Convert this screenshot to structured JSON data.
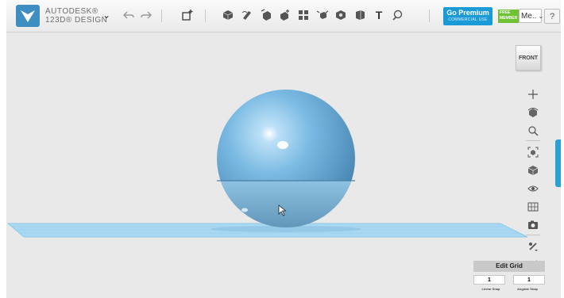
{
  "app": {
    "brand_line1": "AUTODESK®",
    "brand_line2": "123D® DESIGN",
    "logo_icon": "autodesk-logo-icon",
    "menu_caret": "⌄"
  },
  "toolbar": {
    "undo_icon": "undo-icon",
    "redo_icon": "redo-icon",
    "tools": [
      {
        "name": "transform-icon"
      },
      {
        "name": "primitives-icon"
      },
      {
        "name": "sketch-icon"
      },
      {
        "name": "construct-icon"
      },
      {
        "name": "modify-icon"
      },
      {
        "name": "pattern-icon"
      },
      {
        "name": "group-icon"
      },
      {
        "name": "combine-icon"
      },
      {
        "name": "measure-icon"
      },
      {
        "name": "text-icon"
      },
      {
        "name": "snap-icon"
      }
    ],
    "text_tool_label": "T",
    "premium_label": "Go Premium",
    "premium_sub": "COMMERCIAL USE",
    "free_badge": "FREE MEMBER",
    "member_label": "Me..",
    "help_label": "?"
  },
  "viewport": {
    "viewcube_label": "FRONT",
    "nav_icons": [
      "pan-icon",
      "orbit-icon",
      "zoom-icon",
      "fit-icon",
      "views-icon",
      "visibility-icon",
      "grid-icon",
      "screenshot-icon",
      "material-icon",
      "hide-icon"
    ],
    "edit_grid": {
      "title": "Edit Grid",
      "linear_value": "1",
      "angular_value": "1",
      "linear_label": "Linear Snap",
      "angular_label": "Angular Snap"
    },
    "colors": {
      "sphere": "#6fb3de",
      "grid": "#a7d6f0",
      "background": "#e9e9e9",
      "accent": "#1a9bd8"
    }
  }
}
